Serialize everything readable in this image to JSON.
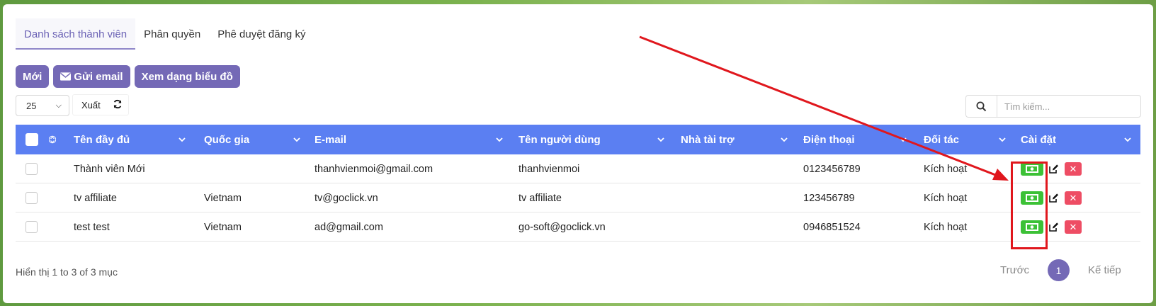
{
  "tabs": [
    {
      "label": "Danh sách thành viên",
      "active": true
    },
    {
      "label": "Phân quyền",
      "active": false
    },
    {
      "label": "Phê duyệt đăng ký",
      "active": false
    }
  ],
  "toolbar": {
    "new_label": "Mới",
    "email_label": "Gửi email",
    "chart_label": "Xem dạng biểu đồ"
  },
  "controls": {
    "page_size": "25",
    "export_label": "Xuất",
    "search_placeholder": "Tìm kiếm..."
  },
  "table": {
    "columns": [
      "Tên đầy đủ",
      "Quốc gia",
      "E-mail",
      "Tên người dùng",
      "Nhà tài trợ",
      "Điện thoại",
      "Đối tác",
      "Cài đặt"
    ],
    "rows": [
      {
        "name": "Thành viên Mới",
        "country": "",
        "email": "thanhvienmoi@gmail.com",
        "username": "thanhvienmoi",
        "sponsor": "",
        "phone": "0123456789",
        "partner": "Kích hoạt"
      },
      {
        "name": "tv affiliate",
        "country": "Vietnam",
        "email": "tv@goclick.vn",
        "username": "tv affiliate",
        "sponsor": "",
        "phone": "123456789",
        "partner": "Kích hoạt"
      },
      {
        "name": "test test",
        "country": "Vietnam",
        "email": "ad@gmail.com",
        "username": "go-soft@goclick.vn",
        "sponsor": "",
        "phone": "0946851524",
        "partner": "Kích hoạt"
      }
    ]
  },
  "footer": {
    "info": "Hiển thị 1 to 3 of 3 mục",
    "prev_label": "Trước",
    "current_page": "1",
    "next_label": "Kế tiếp"
  },
  "colors": {
    "accent": "#7469b6",
    "header": "#5b7ff2",
    "money_button": "#3cc136",
    "delete_button": "#ee4d64",
    "annotation": "#e0171d"
  }
}
